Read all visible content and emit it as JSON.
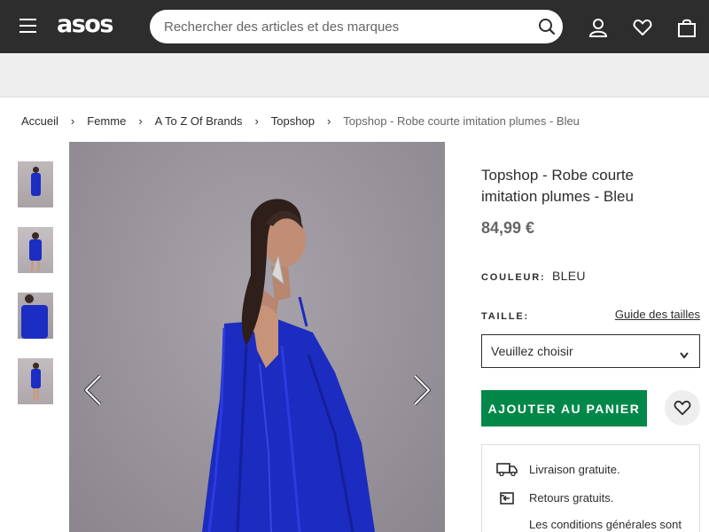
{
  "header": {
    "logo": "asos",
    "search_placeholder": "Rechercher des articles et des marques"
  },
  "breadcrumb": [
    "Accueil",
    "Femme",
    "A To Z Of Brands",
    "Topshop",
    "Topshop - Robe courte imitation plumes - Bleu"
  ],
  "breadcrumb_separator": "›",
  "product": {
    "title": "Topshop - Robe courte imitation plumes - Bleu",
    "price": "84,99 €",
    "color_label": "COULEUR:",
    "color_value": "BLEU",
    "size_label": "TAILLE:",
    "size_guide": "Guide des tailles",
    "size_select": "Veuillez choisir",
    "add_to_bag": "AJOUTER AU PANIER"
  },
  "delivery": {
    "free_delivery": "Livraison gratuite.",
    "free_returns": "Retours gratuits.",
    "conditions": "Les conditions générales sont"
  },
  "colors": {
    "header_bg": "#2d2d2d",
    "add_to_bag_bg": "#018849",
    "dress_blue": "#1c2dc4"
  },
  "icons": [
    "menu-icon",
    "search-icon",
    "account-icon",
    "heart-icon",
    "bag-icon",
    "chevron-left-icon",
    "chevron-right-icon",
    "chevron-down-icon",
    "truck-icon",
    "returns-icon"
  ]
}
